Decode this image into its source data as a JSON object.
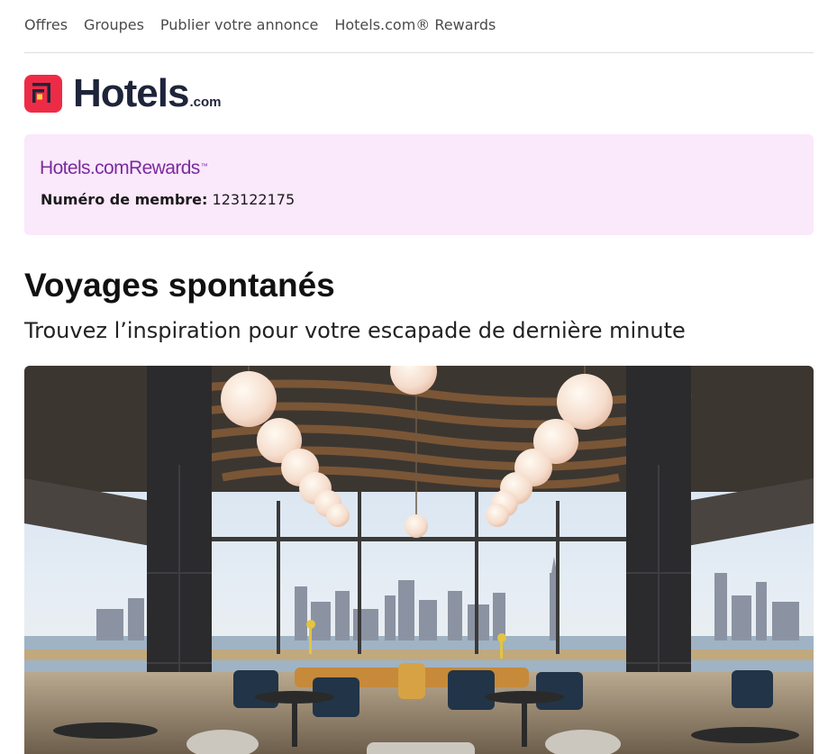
{
  "nav": {
    "items": [
      "Offres",
      "Groupes",
      "Publier votre annonce",
      "Hotels.com® Rewards"
    ]
  },
  "brand": {
    "name": "Hotels",
    "suffix": ".com",
    "icon": "hotels-logo-icon",
    "color": "#ee2b47"
  },
  "rewards": {
    "logo_text": "Hotels.comRewards",
    "logo_tm": "™",
    "member_label": "Numéro de membre:",
    "member_number": "123122175",
    "bg_color": "#fae8fb",
    "logo_color": "#7b2a9e"
  },
  "content": {
    "title": "Voyages spontanés",
    "subtitle": "Trouvez l’inspiration pour votre escapade de dernière minute"
  },
  "hero": {
    "image": "rooftop-restaurant-city-skyline-photo"
  }
}
